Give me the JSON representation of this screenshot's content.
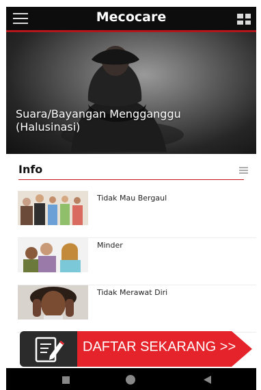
{
  "app": {
    "title": "Mecocare"
  },
  "hero": {
    "caption": "Suara/Bayangan Mengganggu (Halusinasi)",
    "dots": [
      {
        "active": true
      },
      {
        "active": false
      },
      {
        "active": false
      }
    ]
  },
  "info": {
    "heading": "Info",
    "items": [
      {
        "title": "Tidak Mau Bergaul"
      },
      {
        "title": "Minder"
      },
      {
        "title": "Tidak Merawat Diri"
      }
    ]
  },
  "banner": {
    "text": "DAFTAR SEKARANG >>"
  },
  "colors": {
    "accent": "#c2141a",
    "appbar": "#0d0d0d",
    "banner_red": "#e4232a"
  }
}
